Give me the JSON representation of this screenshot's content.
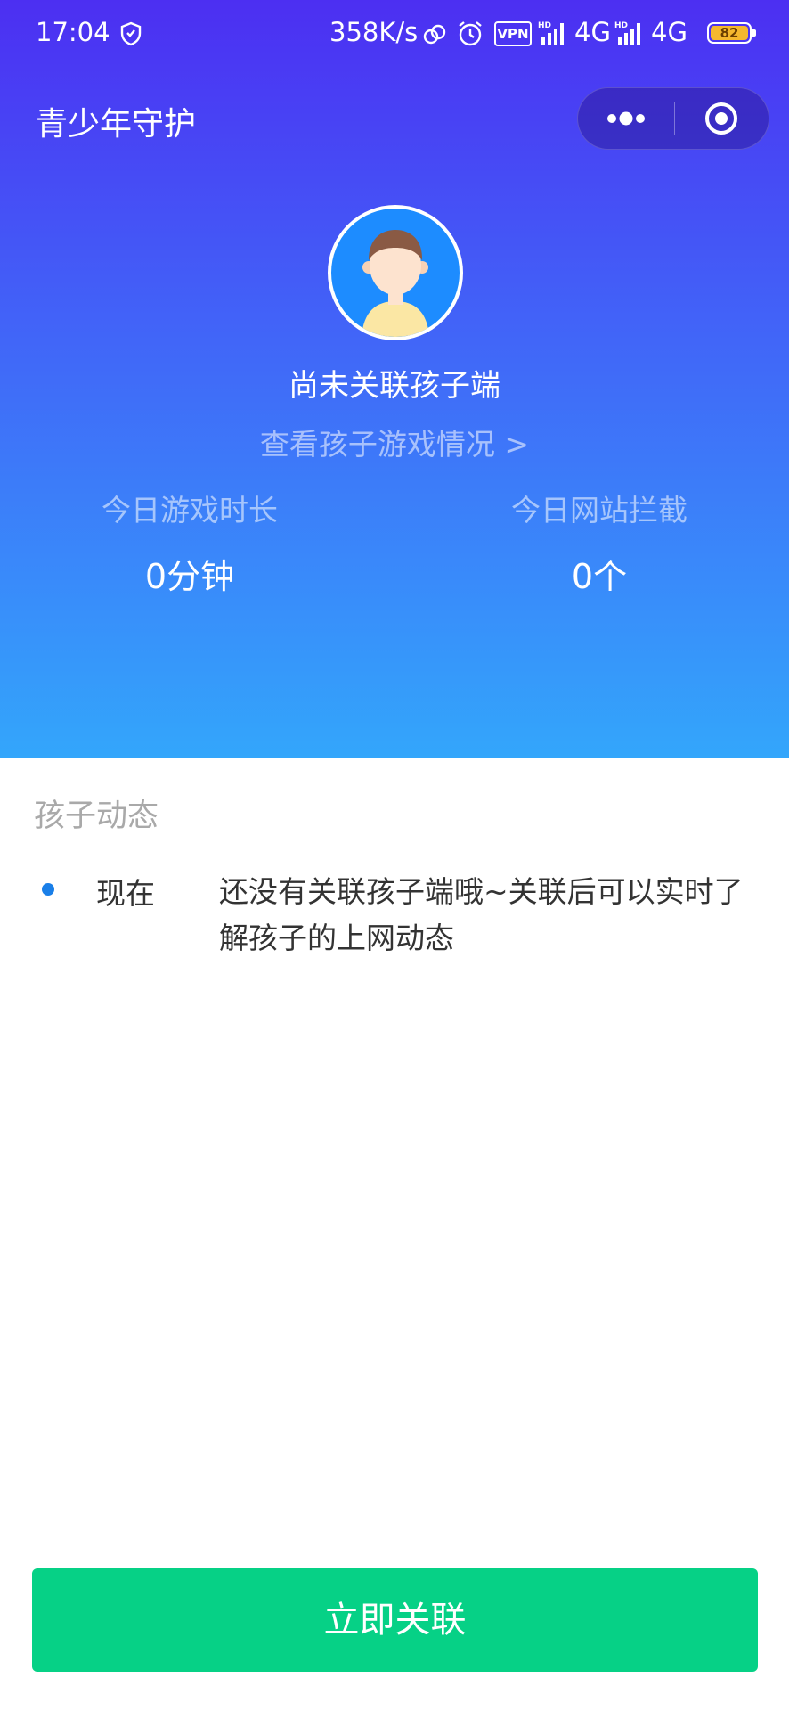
{
  "status_bar": {
    "time": "17:04",
    "network_speed": "358K/s",
    "vpn": "VPN",
    "network1": "4G",
    "network2": "4G",
    "battery": "82",
    "icons": [
      "shield-icon",
      "link-icon",
      "alarm-icon",
      "signal-icon",
      "battery-icon"
    ]
  },
  "nav": {
    "title": "青少年守护",
    "icons": [
      "more-icon",
      "close-target-icon"
    ]
  },
  "profile": {
    "status": "尚未关联孩子端",
    "view_link": "查看孩子游戏情况 >"
  },
  "stats": {
    "game_time_label": "今日游戏时长",
    "game_time_value": "0分钟",
    "blocked_label": "今日网站拦截",
    "blocked_value": "0个"
  },
  "feed": {
    "title": "孩子动态",
    "items": [
      {
        "time": "现在",
        "message": "还没有关联孩子端哦~关联后可以实时了解孩子的上网动态"
      }
    ]
  },
  "button": {
    "label": "立即关联"
  },
  "colors": {
    "accent_green": "#06d186",
    "gradient_top": "#4c2ff2",
    "gradient_bottom": "#33a6fb",
    "dot_blue": "#1a7fe8"
  }
}
